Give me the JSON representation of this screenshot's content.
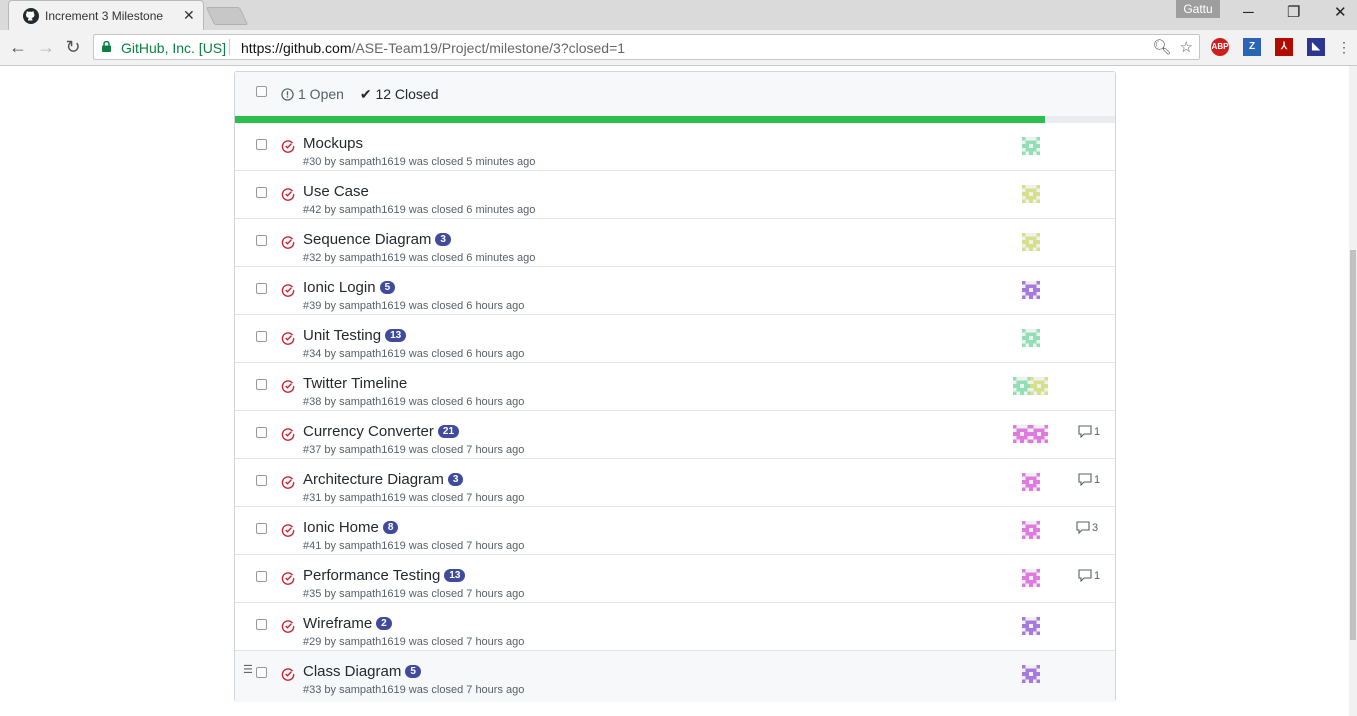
{
  "browser": {
    "tab_title": "Increment 3 Milestone",
    "tab_close": "✕",
    "profile_name": "Gattu",
    "security_org": "GitHub, Inc. [US]",
    "url_scheme_host": "https://github.com",
    "url_path": "/ASE-Team19/Project/milestone/3?closed=1",
    "window_minimize": "─",
    "window_restore": "❐",
    "window_close": "✕"
  },
  "milestone": {
    "open_label": "1 Open",
    "closed_label": "12 Closed",
    "progress_fraction": 0.92
  },
  "issues": [
    {
      "title": "Mockups",
      "badge": "",
      "meta": "#30 by sampath1619 was closed 5 minutes ago",
      "comments": ""
    },
    {
      "title": "Use Case",
      "badge": "",
      "meta": "#42 by sampath1619 was closed 6 minutes ago",
      "comments": ""
    },
    {
      "title": "Sequence Diagram",
      "badge": "3",
      "meta": "#32 by sampath1619 was closed 6 minutes ago",
      "comments": ""
    },
    {
      "title": "Ionic Login",
      "badge": "5",
      "meta": "#39 by sampath1619 was closed 6 hours ago",
      "comments": ""
    },
    {
      "title": "Unit Testing",
      "badge": "13",
      "meta": "#34 by sampath1619 was closed 6 hours ago",
      "comments": ""
    },
    {
      "title": "Twitter Timeline",
      "badge": "",
      "meta": "#38 by sampath1619 was closed 6 hours ago",
      "comments": ""
    },
    {
      "title": "Currency Converter",
      "badge": "21",
      "meta": "#37 by sampath1619 was closed 7 hours ago",
      "comments": "1"
    },
    {
      "title": "Architecture Diagram",
      "badge": "3",
      "meta": "#31 by sampath1619 was closed 7 hours ago",
      "comments": "1"
    },
    {
      "title": "Ionic Home",
      "badge": "8",
      "meta": "#41 by sampath1619 was closed 7 hours ago",
      "comments": "3"
    },
    {
      "title": "Performance Testing",
      "badge": "13",
      "meta": "#35 by sampath1619 was closed 7 hours ago",
      "comments": "1"
    },
    {
      "title": "Wireframe",
      "badge": "2",
      "meta": "#29 by sampath1619 was closed 7 hours ago",
      "comments": ""
    },
    {
      "title": "Class Diagram",
      "badge": "5",
      "meta": "#33 by sampath1619 was closed 7 hours ago",
      "comments": ""
    }
  ],
  "colors": {
    "progress_green": "#2cbe4e",
    "closed_red": "#cb2431",
    "badge_blue": "#3f4b9b",
    "avatar_green": "#8fe0b4",
    "avatar_yellow": "#d6e08a",
    "avatar_purple": "#a679e0",
    "avatar_pink": "#e07ae0"
  },
  "extensions": [
    "ABP",
    "Z"
  ]
}
